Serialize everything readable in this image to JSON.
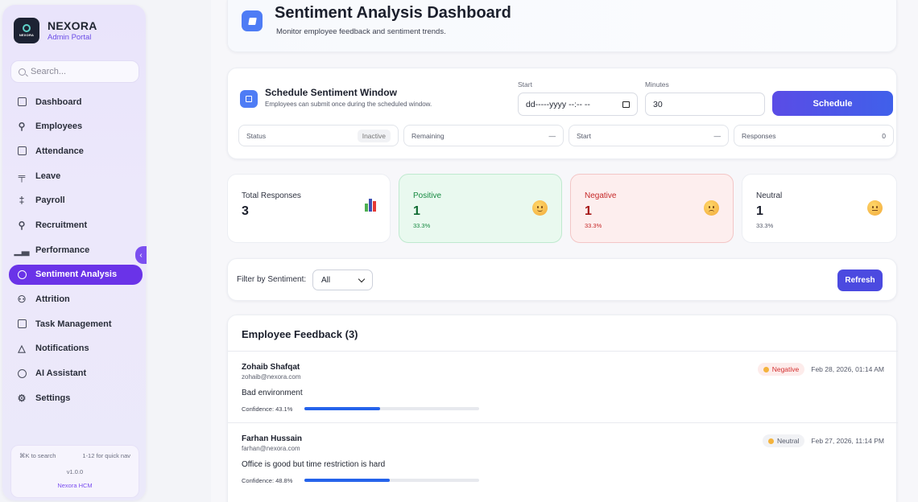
{
  "brand": {
    "name": "NEXORA",
    "subtitle": "Admin Portal",
    "logo_text": "NEXORA"
  },
  "search": {
    "placeholder": "Search..."
  },
  "sidebar": {
    "items": [
      {
        "label": "Dashboard",
        "icon": "grid-icon"
      },
      {
        "label": "Employees",
        "icon": "user-icon"
      },
      {
        "label": "Attendance",
        "icon": "calendar-icon"
      },
      {
        "label": "Leave",
        "icon": "leave-icon"
      },
      {
        "label": "Payroll",
        "icon": "dollar-icon"
      },
      {
        "label": "Recruitment",
        "icon": "user-plus-icon"
      },
      {
        "label": "Performance",
        "icon": "bar-chart-icon"
      },
      {
        "label": "Sentiment Analysis",
        "icon": "smile-icon",
        "active": true
      },
      {
        "label": "Attrition",
        "icon": "users-icon"
      },
      {
        "label": "Task Management",
        "icon": "clipboard-icon"
      },
      {
        "label": "Notifications",
        "icon": "bell-icon"
      },
      {
        "label": "AI Assistant",
        "icon": "chat-icon"
      },
      {
        "label": "Settings",
        "icon": "gear-icon"
      }
    ],
    "footer": {
      "search_hint": "⌘K to search",
      "nav_hint": "1-12 for quick nav",
      "version": "v1.0.0",
      "product": "Nexora HCM"
    },
    "collapse_glyph": "‹"
  },
  "header": {
    "title": "Sentiment Analysis Dashboard",
    "subtitle": "Monitor employee feedback and sentiment trends."
  },
  "schedule": {
    "title": "Schedule Sentiment Window",
    "subtitle": "Employees can submit once during the scheduled window.",
    "start_label": "Start",
    "start_value": "dd-----yyyy --:-- --",
    "minutes_label": "Minutes",
    "minutes_value": "30",
    "button": "Schedule",
    "stats": {
      "status_label": "Status",
      "status_value": "Inactive",
      "remaining_label": "Remaining",
      "remaining_value": "—",
      "start_label": "Start",
      "start_value": "—",
      "responses_label": "Responses",
      "responses_value": "0"
    }
  },
  "kpis": {
    "total": {
      "title": "Total Responses",
      "value": "3"
    },
    "positive": {
      "title": "Positive",
      "value": "1",
      "pct": "33.3%"
    },
    "negative": {
      "title": "Negative",
      "value": "1",
      "pct": "33.3%"
    },
    "neutral": {
      "title": "Neutral",
      "value": "1",
      "pct": "33.3%"
    }
  },
  "filter": {
    "label": "Filter by Sentiment:",
    "selected": "All",
    "refresh": "Refresh"
  },
  "feedback": {
    "title": "Employee Feedback (3)",
    "items": [
      {
        "name": "Zohaib Shafqat",
        "email": "zohaib@nexora.com",
        "text": "Bad environment",
        "confidence": "Confidence: 43.1%",
        "confidence_value": 0.431,
        "sentiment": "Negative",
        "date": "Feb 28, 2026, 01:14 AM"
      },
      {
        "name": "Farhan Hussain",
        "email": "farhan@nexora.com",
        "text": "Office is good but time restriction is hard",
        "confidence": "Confidence: 48.8%",
        "confidence_value": 0.488,
        "sentiment": "Neutral",
        "date": "Feb 27, 2026, 11:14 PM"
      }
    ]
  },
  "colors": {
    "accent": "#6a33e8",
    "primary_button": "#4b4ae0",
    "positive": "#178a42",
    "negative": "#c62828",
    "bar": "#2563eb"
  }
}
